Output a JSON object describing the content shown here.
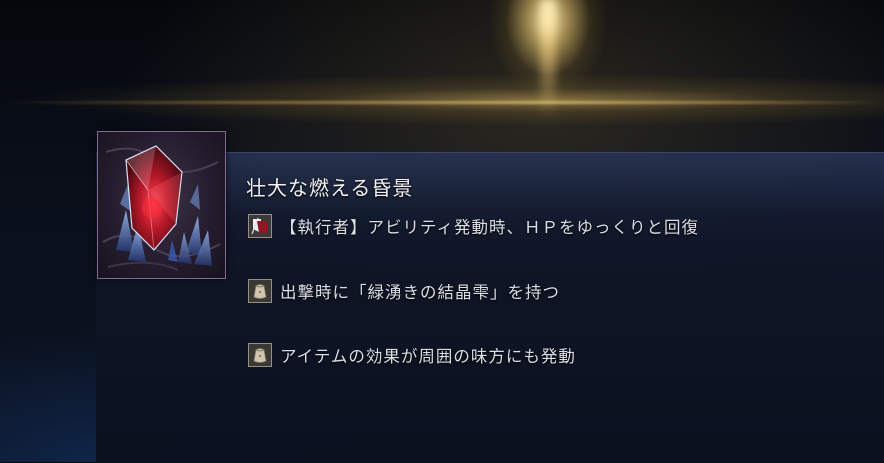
{
  "item": {
    "name": "壮大な燃える昏景",
    "icon": "red-crystal-icon",
    "frame_color": "#7e6b93"
  },
  "effects": [
    {
      "icon": "executor-ability-icon",
      "text": "【執行者】アビリティ発動時、ＨＰをゆっくりと回復"
    },
    {
      "icon": "item-pouch-icon",
      "text": "出撃時に「緑湧きの結晶雫」を持つ"
    },
    {
      "icon": "item-pouch-icon",
      "text": "アイテムの効果が周囲の味方にも発動"
    }
  ],
  "colors": {
    "text": "#dcdee6",
    "title": "#f1f1f3",
    "accent_gold": "#dcc08a",
    "crystal_red": "#c0192a"
  }
}
